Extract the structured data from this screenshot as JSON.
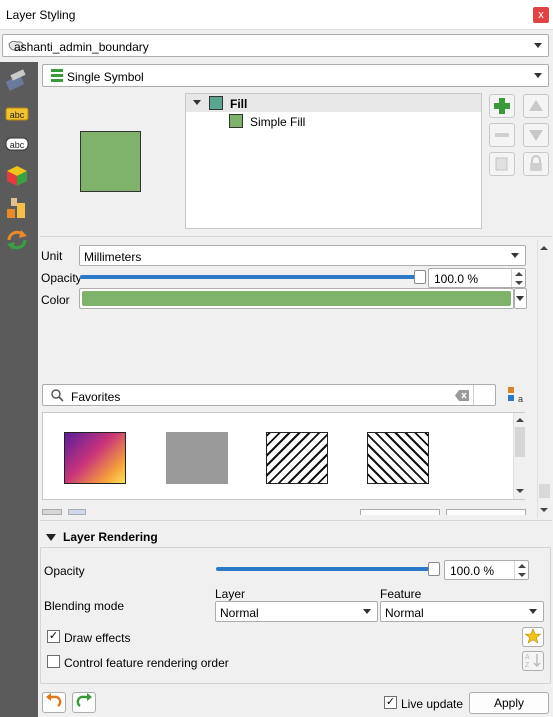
{
  "window": {
    "title": "Layer Styling",
    "close_glyph": "x"
  },
  "layer_select": {
    "value": "ashanti_admin_boundary",
    "icon": "polygon-layer-icon"
  },
  "renderer_select": {
    "value": "Single Symbol",
    "icon": "single-symbol-icon"
  },
  "sidebar": {
    "items": [
      {
        "name": "symbology-icon"
      },
      {
        "name": "labels-icon"
      },
      {
        "name": "labels-abc-icon"
      },
      {
        "name": "3d-view-icon"
      },
      {
        "name": "diagrams-icon"
      },
      {
        "name": "history-icon"
      }
    ]
  },
  "symbol_tree": {
    "root_label": "Fill",
    "child_label": "Simple Fill"
  },
  "symbol_colors": {
    "fill": "#7fb36b",
    "root_swatch": "#5aa58f"
  },
  "unit": {
    "label": "Unit",
    "value": "Millimeters"
  },
  "opacity": {
    "label": "Opacity",
    "value_text": "100.0 %",
    "level": 1.0
  },
  "color": {
    "label": "Color"
  },
  "search": {
    "placeholder": "Favorites"
  },
  "layer_rendering": {
    "title": "Layer Rendering",
    "opacity_label": "Opacity",
    "opacity_value": "100.0 %",
    "opacity_level": 1.0,
    "blending_label": "Blending mode",
    "layer_col": "Layer",
    "feature_col": "Feature",
    "layer_blend": "Normal",
    "feature_blend": "Normal",
    "draw_effects_label": "Draw effects",
    "draw_effects_checked": true,
    "control_order_label": "Control feature rendering order",
    "control_order_checked": false
  },
  "bottom": {
    "live_update_label": "Live update",
    "live_update_checked": true,
    "apply_label": "Apply"
  },
  "accent": "#2c78c9"
}
